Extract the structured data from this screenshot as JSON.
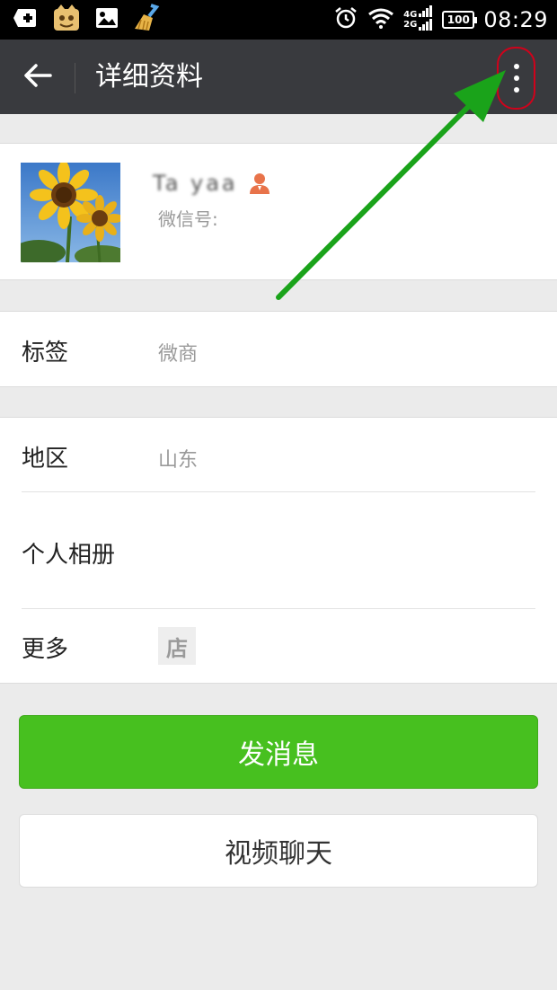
{
  "status_bar": {
    "net_top": "4G",
    "net_bottom": "2G",
    "battery": "100",
    "time": "08:29",
    "icons": [
      "add-square-icon",
      "emoji-sticker-icon",
      "image-icon",
      "broom-icon",
      "alarm-icon",
      "wifi-icon",
      "signal-icon",
      "battery-icon"
    ]
  },
  "app_bar": {
    "title": "详细资料",
    "back_icon": "arrow-left-icon",
    "more_icon": "more-vertical-icon",
    "bg_color": "#393a3e"
  },
  "profile": {
    "name": "Ta yaa",
    "wechat_id_label": "微信号:",
    "gender_icon": "contact-person-icon",
    "avatar": "sunflower-photo"
  },
  "rows": {
    "tag": {
      "label": "标签",
      "value": "微商"
    },
    "region": {
      "label": "地区",
      "value": "山东"
    },
    "album": {
      "label": "个人相册"
    },
    "more": {
      "label": "更多",
      "shop_glyph": "店"
    }
  },
  "buttons": {
    "send_message": "发消息",
    "video_chat": "视频聊天",
    "primary_color": "#47c01f"
  },
  "annotation": {
    "arrow_color": "#1aa31a",
    "highlight_color": "#d0021b"
  }
}
